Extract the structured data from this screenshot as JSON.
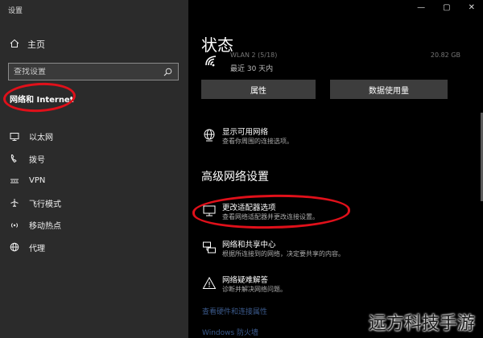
{
  "window": {
    "title": "设置",
    "controls": [
      "—",
      "▢",
      "✕"
    ]
  },
  "sidebar": {
    "home_label": "主页",
    "search_placeholder": "查找设置",
    "section_title": "网络和 Internet",
    "items": [
      {
        "label": "以太网",
        "icon": "monitor-icon"
      },
      {
        "label": "拨号",
        "icon": "phone-icon"
      },
      {
        "label": "VPN",
        "icon": "vpn-icon"
      },
      {
        "label": "飞行模式",
        "icon": "airplane-icon"
      },
      {
        "label": "移动热点",
        "icon": "hotspot-icon"
      },
      {
        "label": "代理",
        "icon": "globe-icon"
      }
    ]
  },
  "main": {
    "status_heading": "状态",
    "wifi": {
      "name": "WLAN 2 (5/18)",
      "data": "20.82 GB",
      "last_time": "最近 30 天内"
    },
    "buttons": {
      "properties": "属性",
      "data_usage": "数据使用量"
    },
    "show_networks": {
      "title": "显示可用网络",
      "subtitle": "查看你周围的连接选项。"
    },
    "advanced_heading": "高级网络设置",
    "adapter": {
      "title": "更改适配器选项",
      "subtitle": "查看网络适配器并更改连接设置。"
    },
    "sharing": {
      "title": "网络和共享中心",
      "subtitle": "根据所连接到的网络，决定要共享的内容。"
    },
    "troubleshoot": {
      "title": "网络疑难解答",
      "subtitle": "诊断并解决网络问题。"
    },
    "faded_links": [
      "查看硬件和连接属性",
      "Windows 防火墙"
    ]
  },
  "watermark": "远方科技手游",
  "colors": {
    "sidebar_bg": "#2b2b2b",
    "main_bg": "#000000",
    "annotation_red": "#e0101a",
    "button_bg": "#3d3d3d"
  }
}
